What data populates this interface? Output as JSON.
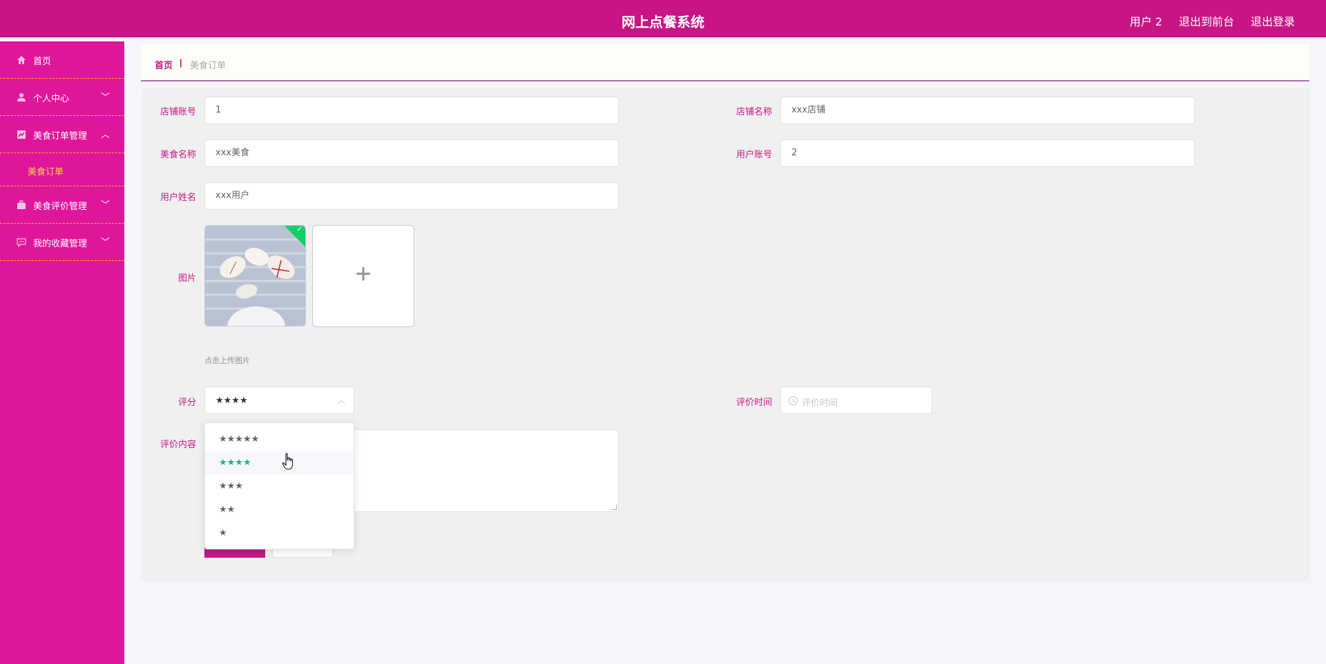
{
  "header": {
    "title": "网上点餐系统",
    "user_label": "用户 2",
    "front_label": "退出到前台",
    "logout_label": "退出登录"
  },
  "sidebar": {
    "items": [
      {
        "label": "首页",
        "icon": "home-icon"
      },
      {
        "label": "个人中心",
        "icon": "user-icon",
        "chevron": "﹀"
      },
      {
        "label": "美食订单管理",
        "icon": "chart-icon",
        "chevron": "︿"
      },
      {
        "label": "美食评价管理",
        "icon": "briefcase-icon",
        "chevron": "﹀"
      },
      {
        "label": "我的收藏管理",
        "icon": "chat-icon",
        "chevron": "﹀"
      }
    ],
    "submenu": {
      "label": "美食订单"
    }
  },
  "breadcrumb": {
    "home": "首页",
    "separator": "|",
    "current": "美食订单"
  },
  "form": {
    "shop_account": {
      "label": "店铺账号",
      "value": "1"
    },
    "shop_name": {
      "label": "店铺名称",
      "value": "xxx店铺"
    },
    "food_name": {
      "label": "美食名称",
      "value": "xxx美食"
    },
    "user_account": {
      "label": "用户账号",
      "value": "2"
    },
    "user_name": {
      "label": "用户姓名",
      "value": "xxx用户"
    },
    "image": {
      "label": "图片",
      "tip": "点击上传图片",
      "add_symbol": "+",
      "check": "✓"
    },
    "rating": {
      "label": "评分",
      "value": "★★★★",
      "arrow": "︿"
    },
    "review_time": {
      "label": "评价时间",
      "placeholder": "评价时间"
    },
    "review_content": {
      "label": "评价内容"
    }
  },
  "rating_options": [
    "★★★★★",
    "★★★★",
    "★★★",
    "★★",
    "★"
  ],
  "colors": {
    "brand": "#c71585",
    "sidebar": "#e0169a",
    "accent": "#f7d74a",
    "selected": "#13b882"
  }
}
